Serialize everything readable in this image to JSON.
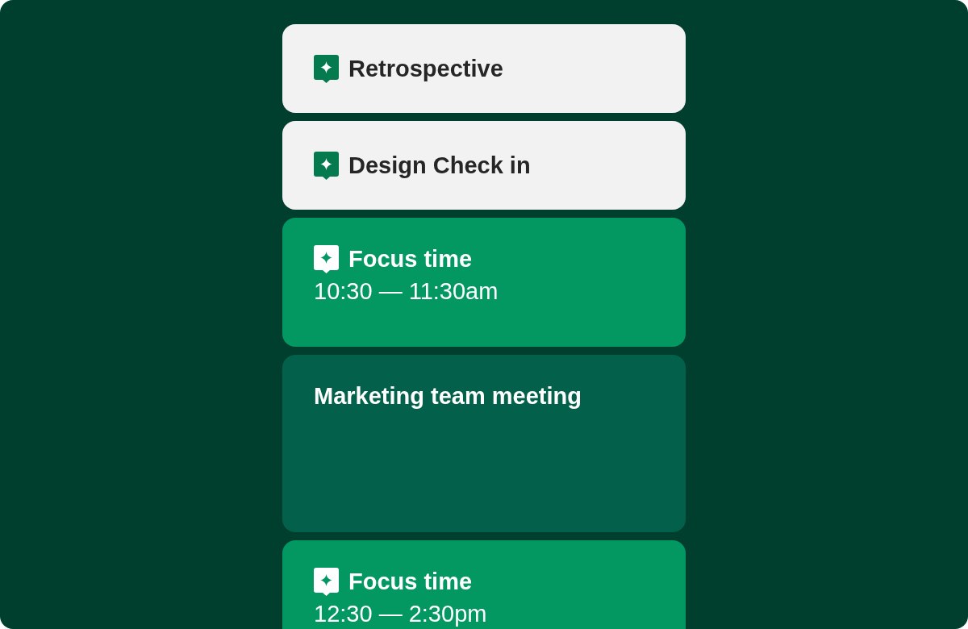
{
  "events": [
    {
      "kind": "light",
      "has_icon": true,
      "title": "Retrospective"
    },
    {
      "kind": "light",
      "has_icon": true,
      "title": "Design Check in"
    },
    {
      "kind": "focus",
      "has_icon": true,
      "title": "Focus time",
      "time": "10:30 — 11:30am"
    },
    {
      "kind": "meeting",
      "has_icon": false,
      "title": "Marketing team meeting"
    },
    {
      "kind": "focus",
      "has_icon": true,
      "title": "Focus time",
      "time": "12:30 — 2:30pm"
    }
  ]
}
